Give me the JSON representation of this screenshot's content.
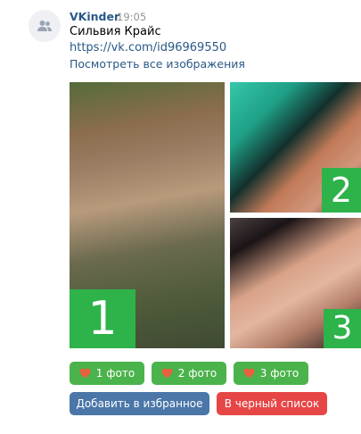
{
  "message": {
    "sender": "VKinder",
    "time": "19:05",
    "name": "Сильвия Крайс",
    "profile_link": "https://vk.com/id96969550",
    "view_all": "Посмотреть все изображения"
  },
  "photos": [
    {
      "badge": "1"
    },
    {
      "badge": "2"
    },
    {
      "badge": "3"
    }
  ],
  "buttons": {
    "photo1": "1 фото",
    "photo2": "2 фото",
    "photo3": "3 фото",
    "favorite": "Добавить в избранное",
    "blacklist": "В черный список"
  },
  "icons": {
    "avatar": "users-icon",
    "like": "heart-icon"
  },
  "colors": {
    "link": "#2a5885",
    "badge": "#2eb24a",
    "green_button": "#4bb34b",
    "blue_button": "#4a76a8",
    "red_button": "#e64646",
    "heart": "#e8613c"
  }
}
